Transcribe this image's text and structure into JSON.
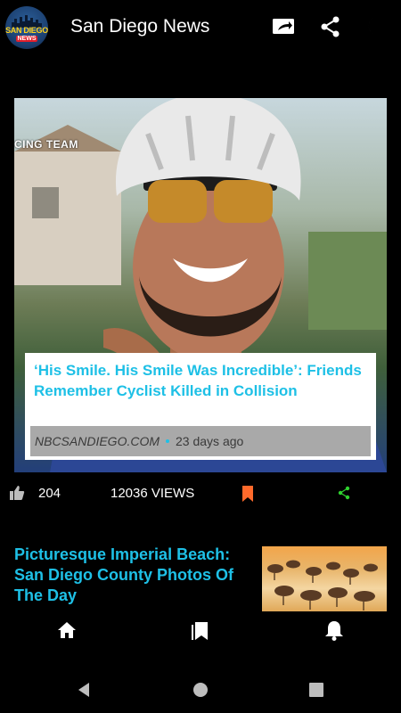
{
  "app": {
    "title": "San Diego News",
    "logo_text_line1": "SAN DIEGO",
    "logo_text_line2": "NEWS"
  },
  "toolbar": {
    "icons": [
      "cast-icon",
      "share-icon",
      "dark-mode-icon"
    ]
  },
  "featured": {
    "image_caption_text": "CING TEAM",
    "headline": "‘His Smile. His Smile Was Incredible’: Friends Remember Cyclist Killed in Collision",
    "source": "NBCSANDIEGO.COM",
    "time_ago": "23 days ago",
    "likes": "204",
    "views": "12036 VIEWS"
  },
  "second_story": {
    "headline": "Picturesque Imperial Beach: San Diego County Photos Of The Day"
  },
  "bottom_nav": {
    "items": [
      "home-icon",
      "bookmarks-icon",
      "notifications-icon"
    ]
  },
  "colors": {
    "accent": "#1ec0e6",
    "bookmark": "#ff6a2b",
    "share": "#2fd12f",
    "background": "#000000"
  }
}
